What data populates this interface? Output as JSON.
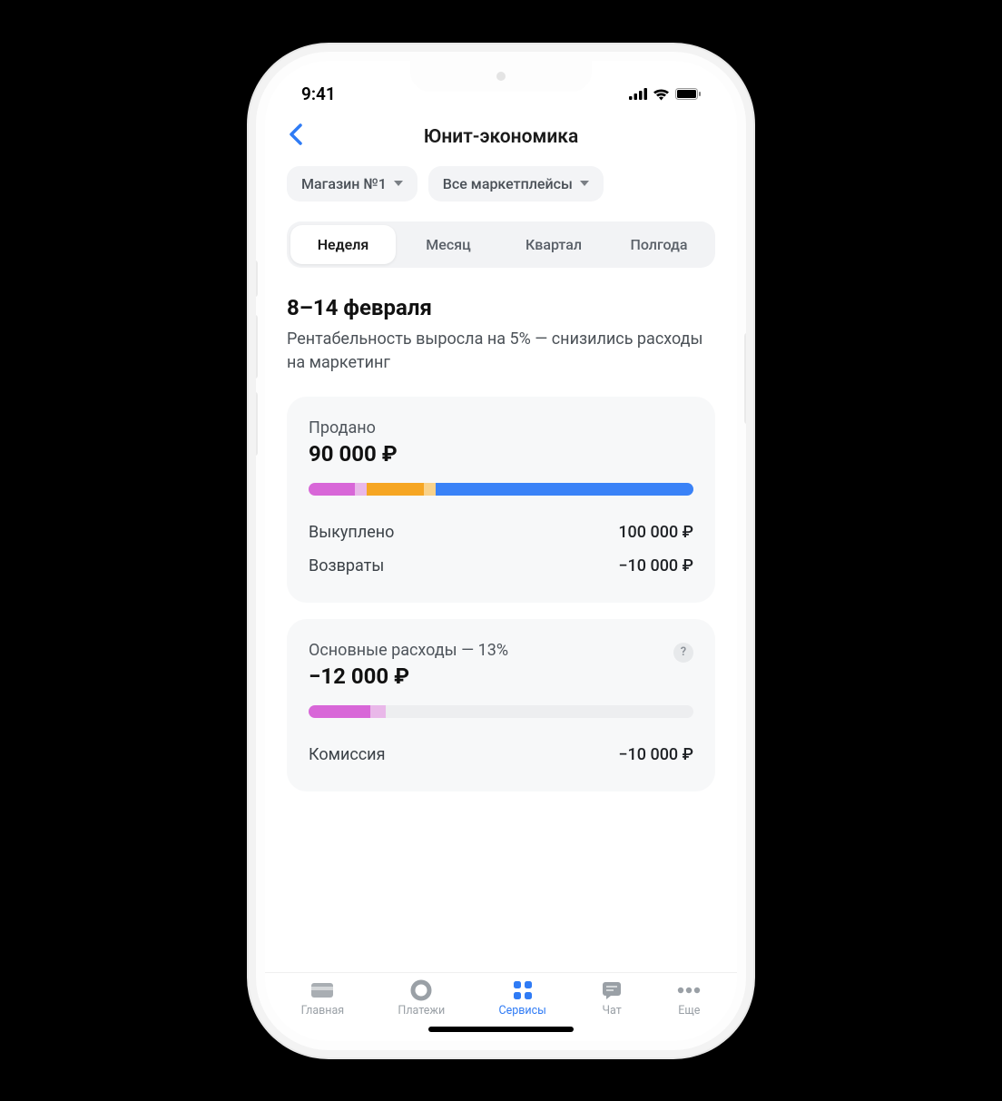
{
  "status": {
    "time": "9:41"
  },
  "header": {
    "title": "Юнит-экономика"
  },
  "filters": {
    "store": "Магазин №1",
    "marketplace": "Все маркетплейсы"
  },
  "period_tabs": [
    "Неделя",
    "Месяц",
    "Квартал",
    "Полгода"
  ],
  "period_active_index": 0,
  "date_range": "8–14 февраля",
  "summary_text": "Рентабельность выросла на 5% — снизились расходы на маркетинг",
  "sold_card": {
    "label": "Продано",
    "value": "90 000 ₽",
    "bar_segments": [
      {
        "color": "#d867d8",
        "width": 12
      },
      {
        "color": "#e9b8e9",
        "width": 3
      },
      {
        "color": "#f6a623",
        "width": 15
      },
      {
        "color": "#f9d28a",
        "width": 3
      },
      {
        "color": "#3a82f7",
        "width": 67
      }
    ],
    "rows": [
      {
        "label": "Выкуплено",
        "value": "100 000 ₽"
      },
      {
        "label": "Возвраты",
        "value": "−10 000 ₽"
      }
    ]
  },
  "expenses_card": {
    "label": "Основные расходы — 13%",
    "value": "−12 000 ₽",
    "bar_segments": [
      {
        "color": "#d867d8",
        "width": 16
      },
      {
        "color": "#e9b8e9",
        "width": 4
      }
    ],
    "rows": [
      {
        "label": "Комиссия",
        "value": "−10 000 ₽"
      }
    ]
  },
  "tabbar": {
    "items": [
      {
        "label": "Главная",
        "icon": "card"
      },
      {
        "label": "Платежи",
        "icon": "circle"
      },
      {
        "label": "Сервисы",
        "icon": "grid"
      },
      {
        "label": "Чат",
        "icon": "chat"
      },
      {
        "label": "Еще",
        "icon": "dots"
      }
    ],
    "active_index": 2
  }
}
